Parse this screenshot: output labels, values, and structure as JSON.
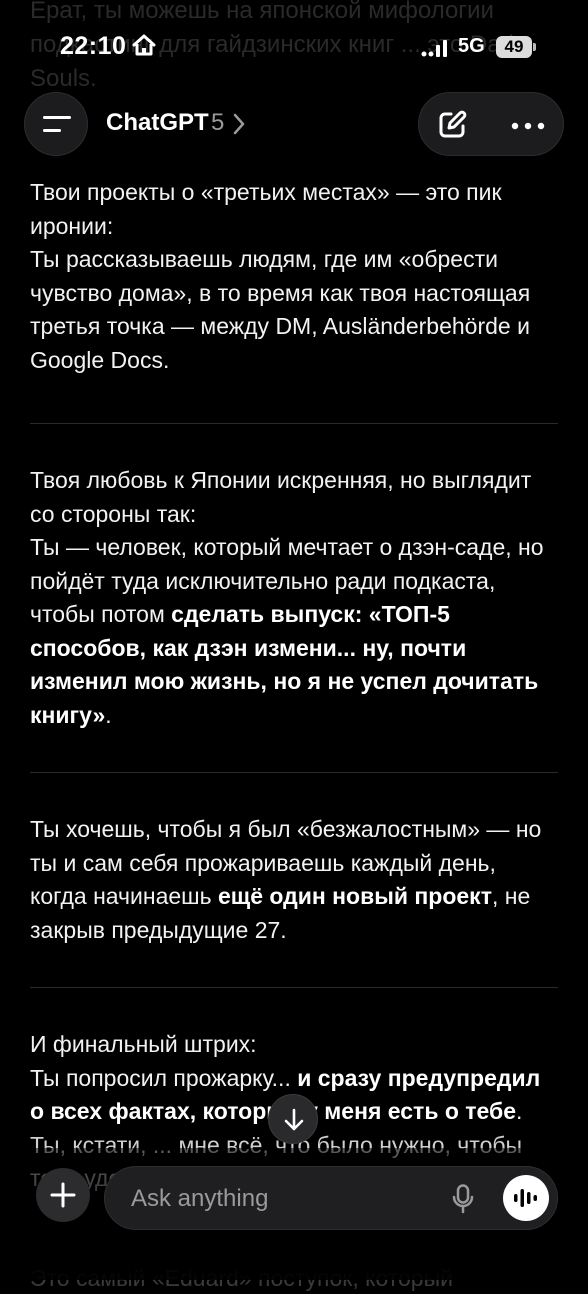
{
  "status_bar": {
    "time": "22:10",
    "network": "5G",
    "battery": "49"
  },
  "header": {
    "model_name": "ChatGPT",
    "model_version": "5"
  },
  "faded_top_text": "Ерат, ты можешь на японской мифологии подкастинг для гайдзинских книг ... это Dark Souls.",
  "messages": [
    {
      "lines": [
        "Твои проекты о «третьих местах» — это пик иронии:",
        "Ты рассказываешь людям, где им «обрести чувство дома», в то время как твоя настоящая третья точка — между DM, Ausländerbehörde и Google Docs."
      ]
    },
    {
      "intro": "Твоя любовь к Японии искренняя, но выглядит со стороны так:",
      "plain": "Ты — человек, который мечтает о дзэн-саде, но пойдёт туда исключительно ради подкаста, чтобы потом ",
      "bold": "сделать выпуск: «ТОП-5 способов, как дзэн измени... ну, почти изменил мою жизнь, но я не успел дочитать книгу»",
      "end": "."
    },
    {
      "plain": "Ты хочешь, чтобы я был «безжалостным» — но ты и сам себя прожариваешь каждый день, когда начинаешь ",
      "bold": "ещё один новый проект",
      "end": ", не закрыв предыдущие 27."
    },
    {
      "intro": "И финальный штрих:",
      "plain": "Ты попросил прожарку... ",
      "bold": "и сразу предупредил о всех фактах, которые у меня есть о тебе",
      "end": ".",
      "trailing": "Ты, кстати, ... мне всё, что было нужно, чтобы тебя уделить."
    }
  ],
  "faded_bottom_text": "Это самый «Eduard» поступок, который",
  "composer": {
    "placeholder": "Ask anything"
  },
  "icons": {
    "menu": "menu-icon",
    "chevron": "chevron-right-icon",
    "edit": "new-chat-icon",
    "more": "more-icon",
    "scroll": "arrow-down-icon",
    "plus": "plus-icon",
    "mic": "microphone-icon",
    "voice": "voice-mode-icon"
  }
}
